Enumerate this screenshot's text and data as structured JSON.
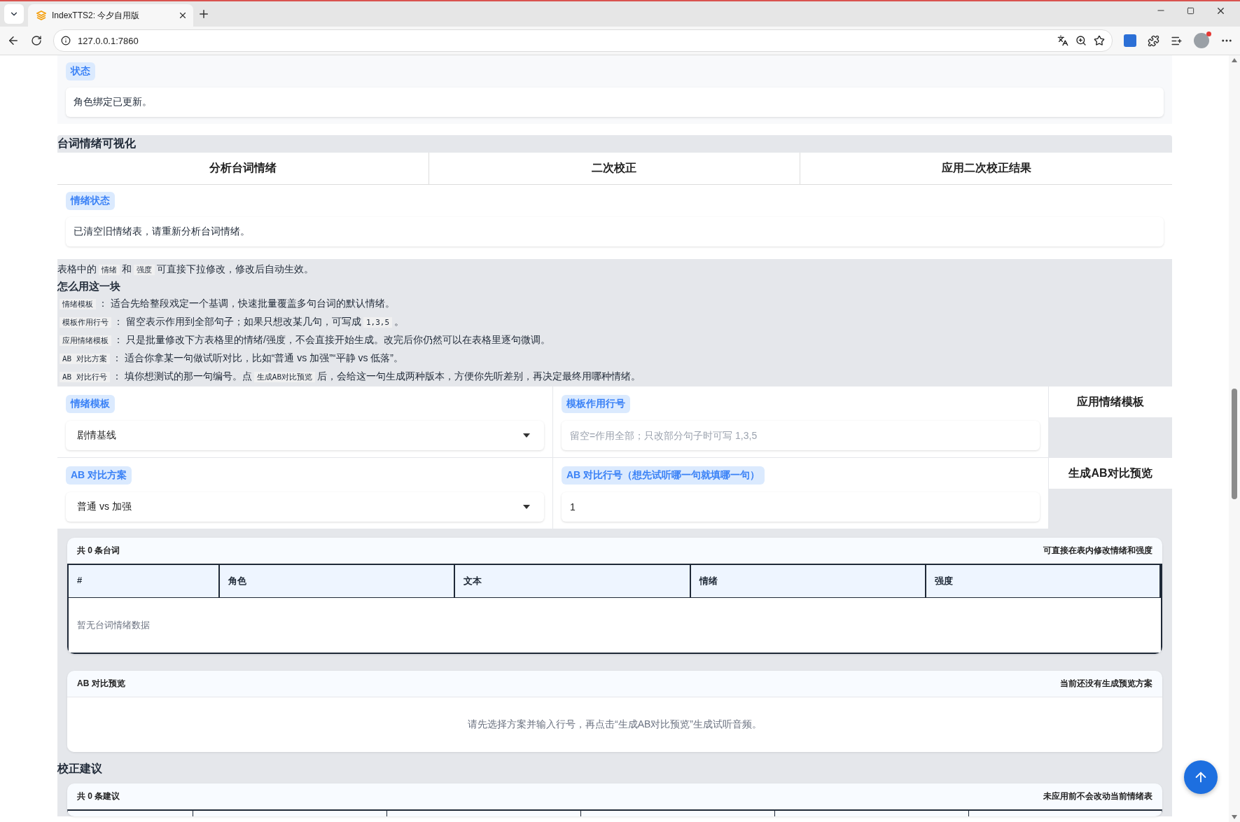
{
  "browser": {
    "tab_title": "IndexTTS2: 今夕自用版",
    "url": "127.0.0.1:7860"
  },
  "status_panel": {
    "label": "状态",
    "text": "角色绑定已更新。"
  },
  "section_title": "台词情绪可视化",
  "action_buttons": [
    "分析台词情绪",
    "二次校正",
    "应用二次校正结果"
  ],
  "emotion_status": {
    "label": "情绪状态",
    "text": "已清空旧情绪表，请重新分析台词情绪。"
  },
  "help": {
    "intro": [
      {
        "kind": "text",
        "text": "表格中的"
      },
      {
        "kind": "code",
        "text": "情绪"
      },
      {
        "kind": "text",
        "text": "和"
      },
      {
        "kind": "code",
        "text": "强度"
      },
      {
        "kind": "text",
        "text": "可直接下拉修改，修改后自动生效。"
      }
    ],
    "heading": "怎么用这一块",
    "items": [
      [
        {
          "kind": "code",
          "text": "情绪模板"
        },
        {
          "kind": "text",
          "text": "： 适合先给整段戏定一个基调，快速批量覆盖多句台词的默认情绪。"
        }
      ],
      [
        {
          "kind": "code",
          "text": "模板作用行号"
        },
        {
          "kind": "text",
          "text": "： 留空表示作用到全部句子；如果只想改某几句，可写成"
        },
        {
          "kind": "code",
          "text": "1,3,5"
        },
        {
          "kind": "text",
          "text": "。"
        }
      ],
      [
        {
          "kind": "code",
          "text": "应用情绪模板"
        },
        {
          "kind": "text",
          "text": "： 只是批量修改下方表格里的情绪/强度，不会直接开始生成。改完后你仍然可以在表格里逐句微调。"
        }
      ],
      [
        {
          "kind": "code",
          "text": "AB 对比方案"
        },
        {
          "kind": "text",
          "text": "： 适合你拿某一句做试听对比，比如“普通 vs 加强”“平静 vs 低落”。"
        }
      ],
      [
        {
          "kind": "code",
          "text": "AB 对比行号"
        },
        {
          "kind": "text",
          "text": "： 填你想测试的那一句编号。点"
        },
        {
          "kind": "code",
          "text": "生成AB对比预览"
        },
        {
          "kind": "text",
          "text": "后，会给这一句生成两种版本，方便你先听差别，再决定最终用哪种情绪。"
        }
      ]
    ]
  },
  "controls": [
    {
      "fields": [
        {
          "kind": "select",
          "label": "情绪模板",
          "value": "剧情基线"
        },
        {
          "kind": "input",
          "label": "模板作用行号",
          "placeholder": "留空=作用全部；只改部分句子时可写 1,3,5"
        }
      ],
      "button": "应用情绪模板"
    },
    {
      "fields": [
        {
          "kind": "select",
          "label": "AB 对比方案",
          "value": "普通 vs 加强"
        },
        {
          "kind": "input",
          "label": "AB 对比行号（想先试听哪一句就填哪一句）",
          "value": "1"
        }
      ],
      "button": "生成AB对比预览"
    }
  ],
  "emotion_table": {
    "count": "共 0 条台词",
    "hint": "可直接在表内修改情绪和强度",
    "columns": [
      "#",
      "角色",
      "文本",
      "情绪",
      "强度"
    ],
    "empty": "暂无台词情绪数据"
  },
  "ab_preview": {
    "title": "AB 对比预览",
    "hint": "当前还没有生成预览方案",
    "message": "请先选择方案并输入行号，再点击“生成AB对比预览”生成试听音频。"
  },
  "suggestions": {
    "title": "校正建议",
    "count": "共 0 条建议",
    "hint": "未应用前不会改动当前情绪表"
  }
}
